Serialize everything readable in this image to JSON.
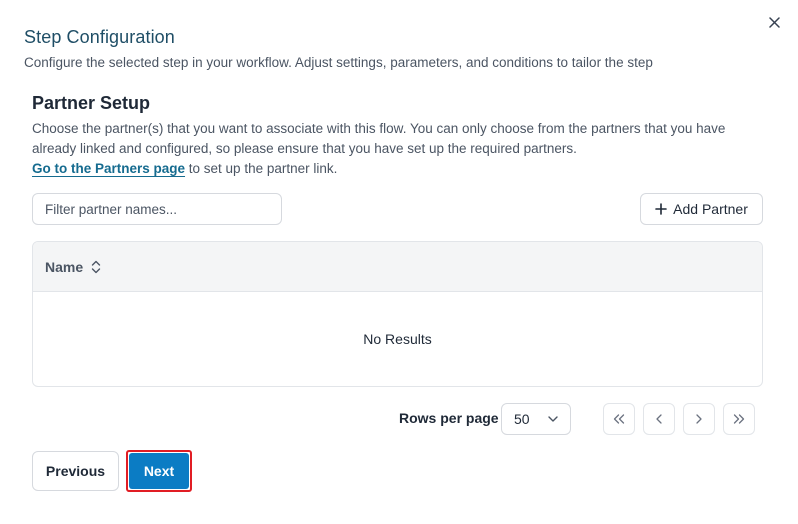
{
  "dialog": {
    "title": "Step Configuration",
    "description": "Configure the selected step in your workflow. Adjust settings, parameters, and conditions to tailor the step",
    "close_icon": "close-icon"
  },
  "section": {
    "title": "Partner Setup",
    "description": "Choose the partner(s) that you want to associate with this flow. You can only choose from the partners that you have already linked and configured, so please ensure that you have set up the required partners.",
    "link_text": "Go to the Partners page",
    "link_suffix": " to set up the partner link."
  },
  "filter": {
    "placeholder": "Filter partner names...",
    "value": ""
  },
  "add_partner": {
    "label": "Add Partner",
    "icon": "plus-icon"
  },
  "table": {
    "columns": [
      {
        "label": "Name",
        "sort_icon": "sort-icon"
      }
    ],
    "rows": [],
    "empty_text": "No Results"
  },
  "pagination": {
    "rows_per_page_label": "Rows per page",
    "rows_per_page_value": "50",
    "buttons": [
      "first-page-icon",
      "previous-page-icon",
      "next-page-icon",
      "last-page-icon"
    ]
  },
  "footer": {
    "previous_label": "Previous",
    "next_label": "Next"
  },
  "colors": {
    "title": "#1f4e66",
    "link": "#156b8f",
    "primary": "#0b7cc4",
    "highlight_border": "#e11d24"
  }
}
